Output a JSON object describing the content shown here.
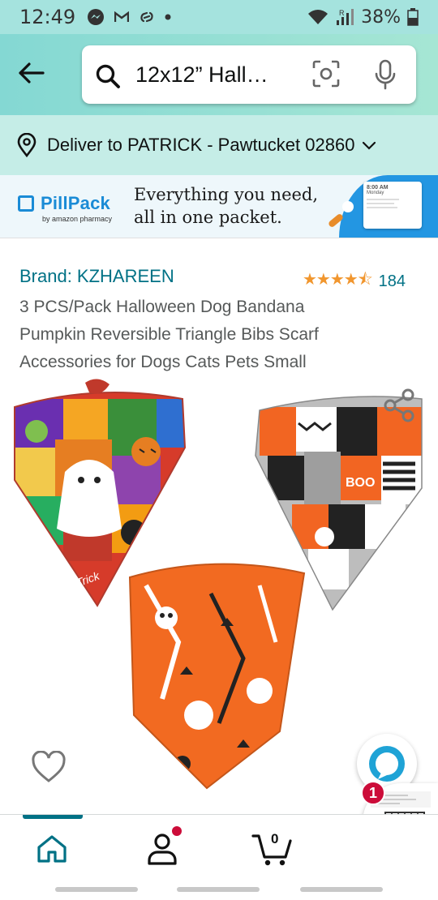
{
  "status_bar": {
    "time": "12:49",
    "notif_icons": [
      "messenger-icon",
      "gmail-icon",
      "link-icon",
      "dot-icon"
    ],
    "battery": "38%",
    "signal_label": "R"
  },
  "search": {
    "query": "12x12” Hall…"
  },
  "delivery": {
    "text": "Deliver to PATRICK - Pawtucket 02860"
  },
  "banner": {
    "brand": "PillPack",
    "brand_sub": "by amazon pharmacy",
    "tagline_1": "Everything you need,",
    "tagline_2": "all in one packet.",
    "card_time": "8:00 AM",
    "card_day": "Monday"
  },
  "product": {
    "brand": "Brand: KZHAREEN",
    "rating": 4.5,
    "stars": "★★★★⯪",
    "rating_count": "184",
    "title_lines": [
      "3 PCS/Pack Halloween Dog Bandana",
      "Pumpkin Reversible Triangle Bibs Scarf",
      "Accessories for Dogs Cats Pets Small"
    ],
    "bandana_text_1": "Trick",
    "bandana_text_2": "BOO"
  },
  "floating": {
    "badge_count": "1"
  },
  "bottom_nav": {
    "cart_count": "0",
    "items": [
      "home-icon",
      "account-icon",
      "cart-icon"
    ]
  },
  "colors": {
    "link": "#007185",
    "star": "#f1962e",
    "header_gradient_start": "#84d8d3",
    "header_gradient_end": "#a6e6d4",
    "badge": "#cc0c39"
  }
}
